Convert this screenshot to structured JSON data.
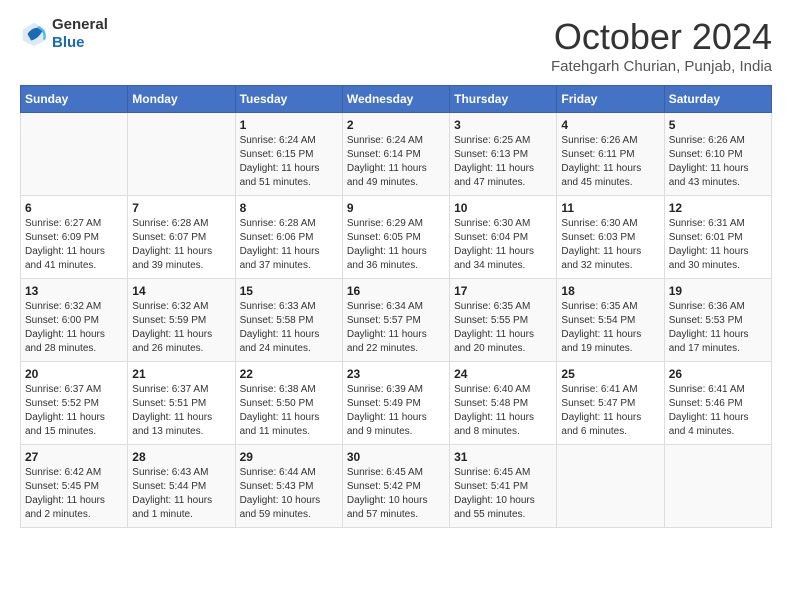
{
  "header": {
    "logo_general": "General",
    "logo_blue": "Blue",
    "month": "October 2024",
    "location": "Fatehgarh Churian, Punjab, India"
  },
  "days_of_week": [
    "Sunday",
    "Monday",
    "Tuesday",
    "Wednesday",
    "Thursday",
    "Friday",
    "Saturday"
  ],
  "weeks": [
    [
      {
        "day": "",
        "content": ""
      },
      {
        "day": "",
        "content": ""
      },
      {
        "day": "1",
        "content": "Sunrise: 6:24 AM\nSunset: 6:15 PM\nDaylight: 11 hours and 51 minutes."
      },
      {
        "day": "2",
        "content": "Sunrise: 6:24 AM\nSunset: 6:14 PM\nDaylight: 11 hours and 49 minutes."
      },
      {
        "day": "3",
        "content": "Sunrise: 6:25 AM\nSunset: 6:13 PM\nDaylight: 11 hours and 47 minutes."
      },
      {
        "day": "4",
        "content": "Sunrise: 6:26 AM\nSunset: 6:11 PM\nDaylight: 11 hours and 45 minutes."
      },
      {
        "day": "5",
        "content": "Sunrise: 6:26 AM\nSunset: 6:10 PM\nDaylight: 11 hours and 43 minutes."
      }
    ],
    [
      {
        "day": "6",
        "content": "Sunrise: 6:27 AM\nSunset: 6:09 PM\nDaylight: 11 hours and 41 minutes."
      },
      {
        "day": "7",
        "content": "Sunrise: 6:28 AM\nSunset: 6:07 PM\nDaylight: 11 hours and 39 minutes."
      },
      {
        "day": "8",
        "content": "Sunrise: 6:28 AM\nSunset: 6:06 PM\nDaylight: 11 hours and 37 minutes."
      },
      {
        "day": "9",
        "content": "Sunrise: 6:29 AM\nSunset: 6:05 PM\nDaylight: 11 hours and 36 minutes."
      },
      {
        "day": "10",
        "content": "Sunrise: 6:30 AM\nSunset: 6:04 PM\nDaylight: 11 hours and 34 minutes."
      },
      {
        "day": "11",
        "content": "Sunrise: 6:30 AM\nSunset: 6:03 PM\nDaylight: 11 hours and 32 minutes."
      },
      {
        "day": "12",
        "content": "Sunrise: 6:31 AM\nSunset: 6:01 PM\nDaylight: 11 hours and 30 minutes."
      }
    ],
    [
      {
        "day": "13",
        "content": "Sunrise: 6:32 AM\nSunset: 6:00 PM\nDaylight: 11 hours and 28 minutes."
      },
      {
        "day": "14",
        "content": "Sunrise: 6:32 AM\nSunset: 5:59 PM\nDaylight: 11 hours and 26 minutes."
      },
      {
        "day": "15",
        "content": "Sunrise: 6:33 AM\nSunset: 5:58 PM\nDaylight: 11 hours and 24 minutes."
      },
      {
        "day": "16",
        "content": "Sunrise: 6:34 AM\nSunset: 5:57 PM\nDaylight: 11 hours and 22 minutes."
      },
      {
        "day": "17",
        "content": "Sunrise: 6:35 AM\nSunset: 5:55 PM\nDaylight: 11 hours and 20 minutes."
      },
      {
        "day": "18",
        "content": "Sunrise: 6:35 AM\nSunset: 5:54 PM\nDaylight: 11 hours and 19 minutes."
      },
      {
        "day": "19",
        "content": "Sunrise: 6:36 AM\nSunset: 5:53 PM\nDaylight: 11 hours and 17 minutes."
      }
    ],
    [
      {
        "day": "20",
        "content": "Sunrise: 6:37 AM\nSunset: 5:52 PM\nDaylight: 11 hours and 15 minutes."
      },
      {
        "day": "21",
        "content": "Sunrise: 6:37 AM\nSunset: 5:51 PM\nDaylight: 11 hours and 13 minutes."
      },
      {
        "day": "22",
        "content": "Sunrise: 6:38 AM\nSunset: 5:50 PM\nDaylight: 11 hours and 11 minutes."
      },
      {
        "day": "23",
        "content": "Sunrise: 6:39 AM\nSunset: 5:49 PM\nDaylight: 11 hours and 9 minutes."
      },
      {
        "day": "24",
        "content": "Sunrise: 6:40 AM\nSunset: 5:48 PM\nDaylight: 11 hours and 8 minutes."
      },
      {
        "day": "25",
        "content": "Sunrise: 6:41 AM\nSunset: 5:47 PM\nDaylight: 11 hours and 6 minutes."
      },
      {
        "day": "26",
        "content": "Sunrise: 6:41 AM\nSunset: 5:46 PM\nDaylight: 11 hours and 4 minutes."
      }
    ],
    [
      {
        "day": "27",
        "content": "Sunrise: 6:42 AM\nSunset: 5:45 PM\nDaylight: 11 hours and 2 minutes."
      },
      {
        "day": "28",
        "content": "Sunrise: 6:43 AM\nSunset: 5:44 PM\nDaylight: 11 hours and 1 minute."
      },
      {
        "day": "29",
        "content": "Sunrise: 6:44 AM\nSunset: 5:43 PM\nDaylight: 10 hours and 59 minutes."
      },
      {
        "day": "30",
        "content": "Sunrise: 6:45 AM\nSunset: 5:42 PM\nDaylight: 10 hours and 57 minutes."
      },
      {
        "day": "31",
        "content": "Sunrise: 6:45 AM\nSunset: 5:41 PM\nDaylight: 10 hours and 55 minutes."
      },
      {
        "day": "",
        "content": ""
      },
      {
        "day": "",
        "content": ""
      }
    ]
  ]
}
